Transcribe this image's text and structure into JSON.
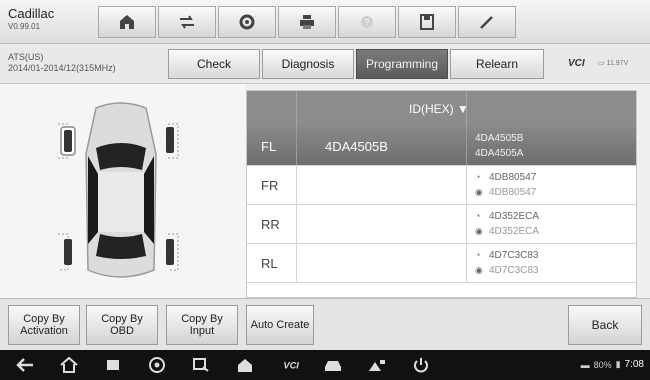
{
  "header": {
    "vehicle_make": "Cadillac",
    "version": "V0.99.01",
    "toolbar_icons": [
      "home-icon",
      "vehicle-swap-icon",
      "settings-icon",
      "print-icon",
      "help-icon",
      "save-icon",
      "edit-icon"
    ]
  },
  "subheader": {
    "system": "ATS(US)",
    "range": "2014/01-2014/12(315MHz)",
    "tabs": [
      {
        "label": "Check",
        "active": false
      },
      {
        "label": "Diagnosis",
        "active": false
      },
      {
        "label": "Programming",
        "active": true
      },
      {
        "label": "Relearn",
        "active": false
      }
    ],
    "vci_label": "VCI",
    "battery": "11.97V"
  },
  "table": {
    "header_label": "ID(HEX) ▼",
    "rows": [
      {
        "position": "FL",
        "current_id": "4DA4505B",
        "ids": [
          "4DA4505B",
          "4DA4505A"
        ],
        "selected": true
      },
      {
        "position": "FR",
        "current_id": "",
        "ids": [
          "4DB80547",
          "4DB80547"
        ],
        "selected": false
      },
      {
        "position": "RR",
        "current_id": "",
        "ids": [
          "4D352ECA",
          "4D352ECA"
        ],
        "selected": false
      },
      {
        "position": "RL",
        "current_id": "",
        "ids": [
          "4D7C3C83",
          "4D7C3C83"
        ],
        "selected": false
      }
    ]
  },
  "buttons": {
    "copy_activation": "Copy By\nActivation",
    "copy_obd": "Copy By\nOBD",
    "copy_input": "Copy By\nInput",
    "auto_create": "Auto Create",
    "back": "Back"
  },
  "statusbar": {
    "battery_percent": "80%",
    "time": "7:08"
  }
}
